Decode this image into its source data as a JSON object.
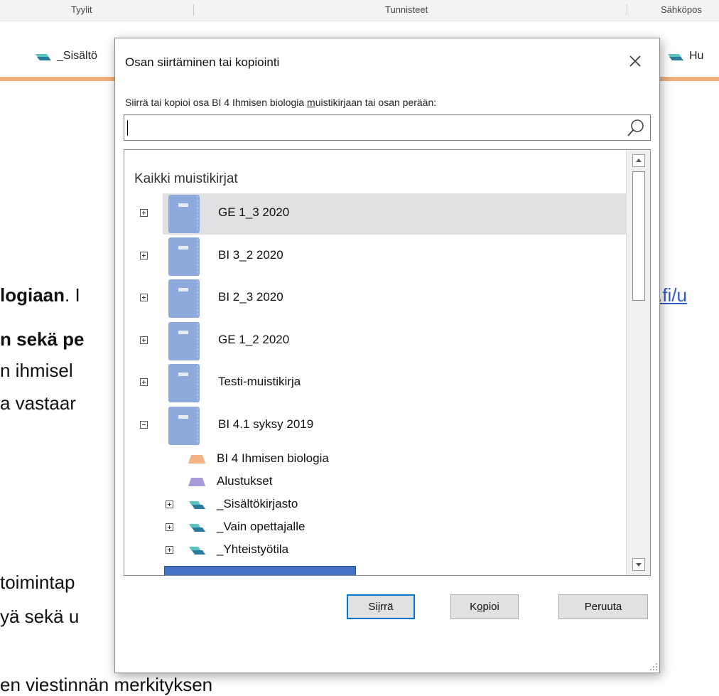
{
  "ribbon": {
    "groups": [
      "Tyylit",
      "Tunnisteet",
      "Sähköpos"
    ]
  },
  "section_tabs": {
    "left": "_Sisältö",
    "right": "Hu"
  },
  "background_text": {
    "line1_left": "logiaan",
    "line1_after": ". I",
    "line1_link": ".fi/u",
    "line2": "n sekä pe",
    "line3": "n ihmisel",
    "line4": "a vastaar",
    "line5": "toimintap",
    "line6": "yä sekä u",
    "line7": "en viestinnän merkityksen"
  },
  "dialog": {
    "title": "Osan siirtäminen tai kopiointi",
    "prompt_before": "Siirrä tai kopioi osa BI 4 Ihmisen biologia ",
    "prompt_underlined": "m",
    "prompt_after": "uistikirjaan tai osan perään:",
    "search_value": "",
    "list_header": "Kaikki muistikirjat",
    "notebooks": [
      {
        "label": "GE 1_3 2020",
        "expanded": false,
        "selected": true
      },
      {
        "label": "BI 3_2 2020",
        "expanded": false,
        "selected": false
      },
      {
        "label": "BI 2_3 2020",
        "expanded": false,
        "selected": false
      },
      {
        "label": "GE 1_2 2020",
        "expanded": false,
        "selected": false
      },
      {
        "label": "Testi-muistikirja",
        "expanded": false,
        "selected": false
      },
      {
        "label": "BI 4.1 syksy 2019",
        "expanded": true,
        "selected": false
      }
    ],
    "sections": [
      {
        "label": "BI 4 Ihmisen biologia",
        "kind": "section",
        "color": "#f4b183"
      },
      {
        "label": "Alustukset",
        "kind": "section",
        "color": "#a99ad8"
      },
      {
        "label": "_Sisältökirjasto",
        "kind": "group",
        "color": "#3f9fb0"
      },
      {
        "label": "_Vain opettajalle",
        "kind": "group",
        "color": "#3f9fb0"
      },
      {
        "label": "_Yhteistyötila",
        "kind": "group",
        "color": "#3f9fb0"
      }
    ],
    "buttons": {
      "move_before": "Si",
      "move_underlined": "i",
      "move_after": "rrä",
      "copy_before": "K",
      "copy_underlined": "o",
      "copy_after": "pioi",
      "cancel": "Peruuta"
    }
  },
  "colors": {
    "notebook_icon": "#8ea9db",
    "redaction": "#4472c4",
    "accent_line": "#f0b07c",
    "link": "#3458c9"
  }
}
